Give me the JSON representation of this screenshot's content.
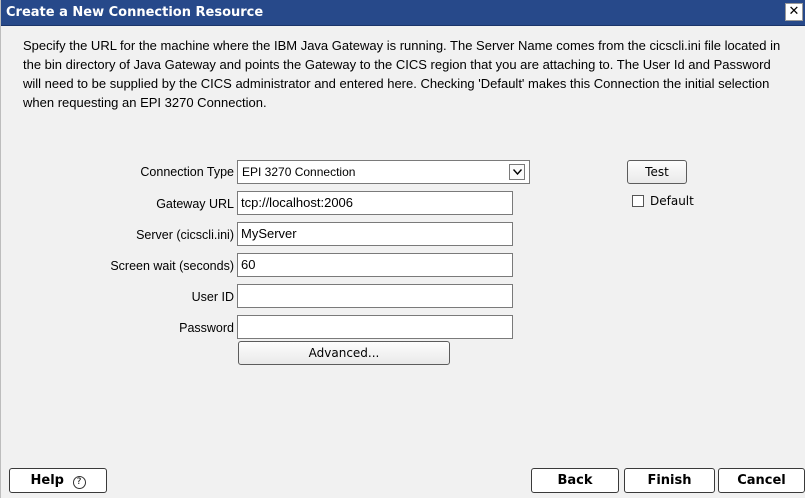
{
  "window": {
    "title": "Create a New Connection Resource",
    "close_glyph": "✕"
  },
  "description": "Specify the URL for the machine where the IBM Java Gateway is running. The Server Name comes from the cicscli.ini file located in the bin directory of Java Gateway and points the Gateway to the CICS region that you are attaching to. The User Id and Password will need to be supplied by the CICS administrator and entered here. Checking 'Default' makes this Connection the initial selection when requesting an EPI 3270 Connection.",
  "form": {
    "connection_type": {
      "label": "Connection Type",
      "value": "EPI 3270 Connection"
    },
    "gateway_url": {
      "label": "Gateway URL",
      "value": "tcp://localhost:2006"
    },
    "server": {
      "label": "Server (cicscli.ini)",
      "value": "MyServer"
    },
    "screen_wait": {
      "label": "Screen wait (seconds)",
      "value": "60"
    },
    "user_id": {
      "label": "User ID",
      "value": ""
    },
    "password": {
      "label": "Password",
      "value": ""
    },
    "advanced_label": "Advanced...",
    "test_label": "Test",
    "default_checkbox": {
      "label": "Default",
      "checked": false
    }
  },
  "footer": {
    "help_label": "Help",
    "help_icon_glyph": "?",
    "back_label": "Back",
    "finish_label": "Finish",
    "cancel_label": "Cancel"
  },
  "icons": {
    "close": "close-icon",
    "dropdown": "chevron-down-icon",
    "help": "help-icon"
  },
  "colors": {
    "titlebar": "#27498a",
    "dialog_background": "#f1f1f1"
  }
}
